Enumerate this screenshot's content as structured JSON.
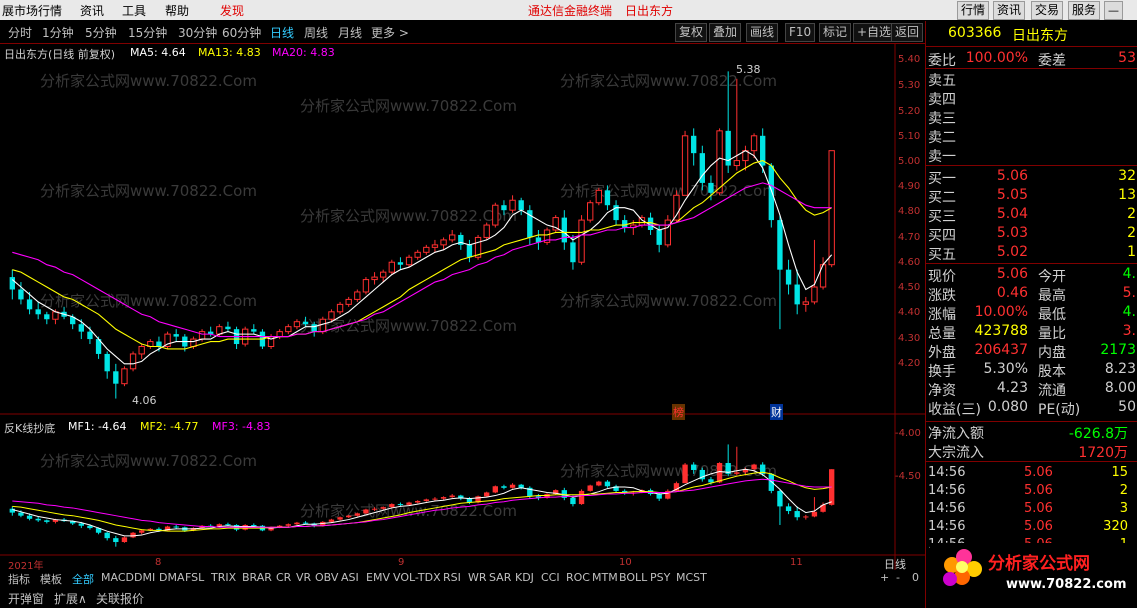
{
  "menu": {
    "items": [
      "展市场行情",
      "资讯",
      "工具",
      "帮助",
      "发现"
    ],
    "promo": [
      "通达信金融终端",
      "日出东方"
    ],
    "right_buttons": [
      "行情",
      "资讯",
      "交易",
      "服务"
    ]
  },
  "toolbar": {
    "periods": [
      "分时",
      "1分钟",
      "5分钟",
      "15分钟",
      "30分钟",
      "60分钟",
      "日线",
      "周线",
      "月线",
      "更多 >"
    ],
    "selected": "日线",
    "actions": [
      "复权",
      "叠加",
      "画线",
      "F10",
      "标记",
      "+自选",
      "返回"
    ]
  },
  "main_chart": {
    "title": "日出东方(日线 前复权)",
    "ma_labels": [
      {
        "text": "MA5: 4.64",
        "color": "#ffffff"
      },
      {
        "text": "MA13: 4.83",
        "color": "#ffff00"
      },
      {
        "text": "MA20: 4.83",
        "color": "#ff00ff"
      }
    ],
    "high_label": "5.38",
    "low_label": "4.06",
    "price_ticks": [
      "5.40",
      "5.30",
      "5.20",
      "5.10",
      "5.00",
      "4.90",
      "4.80",
      "4.70",
      "4.60",
      "4.50",
      "4.40",
      "4.30",
      "4.20"
    ],
    "markers": [
      "榜",
      "财"
    ]
  },
  "sub_chart": {
    "title": "反K线抄底",
    "labels": [
      {
        "text": "MF1: -4.64",
        "color": "#ffffff"
      },
      {
        "text": "MF2: -4.77",
        "color": "#ffff00"
      },
      {
        "text": "MF3: -4.83",
        "color": "#ff00ff"
      }
    ],
    "ticks": [
      "-4.00",
      "-4.50"
    ]
  },
  "time_axis": [
    "2021年",
    "8",
    "9",
    "10",
    "11"
  ],
  "period_label": "日线",
  "indicator_tabs": [
    "指标",
    "模板",
    "全部",
    "MACD",
    "DMI",
    "DMA",
    "FSL",
    "TRIX",
    "BRAR",
    "CR",
    "VR",
    "OBV",
    "ASI",
    "EMV",
    "VOL-TDX",
    "RSI",
    "WR",
    "SAR",
    "KDJ",
    "CCI",
    "ROC",
    "MTM",
    "BOLL",
    "PSY",
    "MCST"
  ],
  "bottom_tabs": [
    "开弹窗",
    "扩展∧",
    "关联报价"
  ],
  "zoom": {
    "plus": "+",
    "minus": "-",
    "value": "0"
  },
  "quote": {
    "code": "603366",
    "name": "日出东方",
    "weibi_label": "委比",
    "weibi": "100.00%",
    "weicha_label": "委差",
    "weicha": "53",
    "asks": [
      {
        "label": "卖五"
      },
      {
        "label": "卖四"
      },
      {
        "label": "卖三"
      },
      {
        "label": "卖二"
      },
      {
        "label": "卖一"
      }
    ],
    "bids": [
      {
        "label": "买一",
        "price": "5.06",
        "vol": "32"
      },
      {
        "label": "买二",
        "price": "5.05",
        "vol": "13"
      },
      {
        "label": "买三",
        "price": "5.04",
        "vol": "2"
      },
      {
        "label": "买四",
        "price": "5.03",
        "vol": "2"
      },
      {
        "label": "买五",
        "price": "5.02",
        "vol": "1"
      }
    ],
    "stats": [
      {
        "l1": "现价",
        "v1": "5.06",
        "c1": "#ff3030",
        "l2": "今开",
        "v2": "4.",
        "c2": "#00ff00"
      },
      {
        "l1": "涨跌",
        "v1": "0.46",
        "c1": "#ff3030",
        "l2": "最高",
        "v2": "5.",
        "c2": "#ff3030"
      },
      {
        "l1": "涨幅",
        "v1": "10.00%",
        "c1": "#ff3030",
        "l2": "最低",
        "v2": "4.",
        "c2": "#00ff00"
      },
      {
        "l1": "总量",
        "v1": "423788",
        "c1": "#ffff00",
        "l2": "量比",
        "v2": "3.",
        "c2": "#ff3030"
      },
      {
        "l1": "外盘",
        "v1": "206437",
        "c1": "#ff3030",
        "l2": "内盘",
        "v2": "2173",
        "c2": "#00ff00"
      },
      {
        "l1": "换手",
        "v1": "5.30%",
        "c1": "#d0d0d0",
        "l2": "股本",
        "v2": "8.23",
        "c2": "#d0d0d0"
      },
      {
        "l1": "净资",
        "v1": "4.23",
        "c1": "#d0d0d0",
        "l2": "流通",
        "v2": "8.00",
        "c2": "#d0d0d0"
      },
      {
        "l1": "收益(三)",
        "v1": "0.080",
        "c1": "#d0d0d0",
        "l2": "PE(动)",
        "v2": "50",
        "c2": "#d0d0d0"
      }
    ],
    "flow": [
      {
        "label": "净流入额",
        "value": "-626.8万",
        "color": "#00ff00"
      },
      {
        "label": "大宗流入",
        "value": "1720万",
        "color": "#ff3030"
      }
    ],
    "ticks": [
      {
        "t": "14:56",
        "p": "5.06",
        "v": "15"
      },
      {
        "t": "14:56",
        "p": "5.06",
        "v": "2"
      },
      {
        "t": "14:56",
        "p": "5.06",
        "v": "3"
      },
      {
        "t": "14:56",
        "p": "5.06",
        "v": "320"
      },
      {
        "t": "14:56",
        "p": "5.06",
        "v": "1"
      }
    ]
  },
  "watermark": "分析家公式网www.70822.Com",
  "logo": {
    "text": "分析家公式网",
    "url": "www.70822.com"
  },
  "chart_data": {
    "type": "candlestick",
    "ylim": [
      4.03,
      5.45
    ],
    "candles": [
      [
        4.55,
        4.58,
        4.46,
        4.5
      ],
      [
        4.5,
        4.53,
        4.44,
        4.46
      ],
      [
        4.46,
        4.49,
        4.4,
        4.42
      ],
      [
        4.42,
        4.45,
        4.38,
        4.4
      ],
      [
        4.4,
        4.41,
        4.36,
        4.38
      ],
      [
        4.38,
        4.42,
        4.36,
        4.41
      ],
      [
        4.41,
        4.43,
        4.38,
        4.39
      ],
      [
        4.39,
        4.4,
        4.34,
        4.36
      ],
      [
        4.36,
        4.38,
        4.3,
        4.33
      ],
      [
        4.33,
        4.35,
        4.28,
        4.3
      ],
      [
        4.3,
        4.31,
        4.22,
        4.24
      ],
      [
        4.24,
        4.25,
        4.14,
        4.17
      ],
      [
        4.17,
        4.2,
        4.06,
        4.12
      ],
      [
        4.12,
        4.19,
        4.11,
        4.18
      ],
      [
        4.18,
        4.25,
        4.17,
        4.24
      ],
      [
        4.24,
        4.28,
        4.22,
        4.27
      ],
      [
        4.27,
        4.3,
        4.26,
        4.29
      ],
      [
        4.29,
        4.31,
        4.25,
        4.27
      ],
      [
        4.27,
        4.33,
        4.26,
        4.32
      ],
      [
        4.32,
        4.34,
        4.29,
        4.31
      ],
      [
        4.31,
        4.32,
        4.25,
        4.27
      ],
      [
        4.27,
        4.31,
        4.26,
        4.3
      ],
      [
        4.3,
        4.34,
        4.29,
        4.33
      ],
      [
        4.33,
        4.35,
        4.31,
        4.32
      ],
      [
        4.32,
        4.36,
        4.31,
        4.35
      ],
      [
        4.35,
        4.37,
        4.33,
        4.34
      ],
      [
        4.34,
        4.35,
        4.26,
        4.28
      ],
      [
        4.28,
        4.35,
        4.27,
        4.34
      ],
      [
        4.34,
        4.36,
        4.32,
        4.33
      ],
      [
        4.33,
        4.34,
        4.26,
        4.27
      ],
      [
        4.27,
        4.32,
        4.26,
        4.31
      ],
      [
        4.31,
        4.34,
        4.3,
        4.33
      ],
      [
        4.33,
        4.36,
        4.32,
        4.35
      ],
      [
        4.35,
        4.38,
        4.34,
        4.37
      ],
      [
        4.37,
        4.39,
        4.35,
        4.36
      ],
      [
        4.36,
        4.37,
        4.31,
        4.33
      ],
      [
        4.33,
        4.39,
        4.32,
        4.38
      ],
      [
        4.38,
        4.42,
        4.37,
        4.41
      ],
      [
        4.41,
        4.45,
        4.4,
        4.44
      ],
      [
        4.44,
        4.47,
        4.43,
        4.46
      ],
      [
        4.46,
        4.5,
        4.45,
        4.49
      ],
      [
        4.49,
        4.55,
        4.48,
        4.54
      ],
      [
        4.54,
        4.57,
        4.52,
        4.55
      ],
      [
        4.55,
        4.58,
        4.53,
        4.57
      ],
      [
        4.57,
        4.62,
        4.56,
        4.61
      ],
      [
        4.61,
        4.63,
        4.58,
        4.6
      ],
      [
        4.6,
        4.64,
        4.59,
        4.63
      ],
      [
        4.63,
        4.66,
        4.62,
        4.65
      ],
      [
        4.65,
        4.68,
        4.64,
        4.67
      ],
      [
        4.67,
        4.7,
        4.65,
        4.68
      ],
      [
        4.68,
        4.71,
        4.66,
        4.7
      ],
      [
        4.7,
        4.74,
        4.69,
        4.72
      ],
      [
        4.72,
        4.73,
        4.66,
        4.68
      ],
      [
        4.68,
        4.7,
        4.61,
        4.63
      ],
      [
        4.63,
        4.72,
        4.62,
        4.71
      ],
      [
        4.71,
        4.77,
        4.7,
        4.76
      ],
      [
        4.76,
        4.85,
        4.75,
        4.84
      ],
      [
        4.84,
        4.86,
        4.8,
        4.82
      ],
      [
        4.82,
        4.88,
        4.81,
        4.86
      ],
      [
        4.86,
        4.87,
        4.8,
        4.82
      ],
      [
        4.82,
        4.84,
        4.68,
        4.71
      ],
      [
        4.71,
        4.74,
        4.66,
        4.69
      ],
      [
        4.69,
        4.75,
        4.68,
        4.74
      ],
      [
        4.74,
        4.8,
        4.73,
        4.79
      ],
      [
        4.79,
        4.82,
        4.66,
        4.69
      ],
      [
        4.69,
        4.72,
        4.58,
        4.61
      ],
      [
        4.61,
        4.8,
        4.6,
        4.78
      ],
      [
        4.78,
        4.86,
        4.77,
        4.85
      ],
      [
        4.85,
        4.91,
        4.84,
        4.9
      ],
      [
        4.9,
        4.92,
        4.82,
        4.84
      ],
      [
        4.84,
        4.86,
        4.76,
        4.78
      ],
      [
        4.78,
        4.8,
        4.73,
        4.75
      ],
      [
        4.75,
        4.78,
        4.72,
        4.76
      ],
      [
        4.76,
        4.8,
        4.75,
        4.79
      ],
      [
        4.79,
        4.81,
        4.72,
        4.74
      ],
      [
        4.74,
        4.76,
        4.65,
        4.68
      ],
      [
        4.68,
        4.8,
        4.67,
        4.78
      ],
      [
        4.78,
        4.9,
        4.77,
        4.88
      ],
      [
        4.88,
        5.14,
        4.88,
        5.12
      ],
      [
        5.12,
        5.15,
        5.0,
        5.05
      ],
      [
        5.05,
        5.08,
        4.9,
        4.93
      ],
      [
        4.93,
        4.96,
        4.86,
        4.89
      ],
      [
        4.89,
        5.15,
        4.88,
        5.14
      ],
      [
        5.14,
        5.38,
        4.97,
        5.0
      ],
      [
        5.0,
        5.35,
        4.98,
        5.02
      ],
      [
        5.02,
        5.08,
        4.98,
        5.06
      ],
      [
        5.06,
        5.13,
        5.03,
        5.12
      ],
      [
        5.12,
        5.15,
        4.97,
        5.0
      ],
      [
        5.0,
        5.01,
        4.75,
        4.78
      ],
      [
        4.78,
        4.8,
        4.34,
        4.58
      ],
      [
        4.58,
        4.62,
        4.48,
        4.52
      ],
      [
        4.52,
        4.58,
        4.4,
        4.44
      ],
      [
        4.44,
        4.47,
        4.41,
        4.45
      ],
      [
        4.45,
        4.7,
        4.44,
        4.51
      ],
      [
        4.51,
        4.63,
        4.5,
        4.6
      ],
      [
        4.6,
        5.06,
        4.59,
        5.06
      ]
    ],
    "series": [
      {
        "name": "MA5",
        "color": "#ffffff",
        "values": [
          4.54,
          4.51,
          4.48,
          4.45,
          4.43,
          4.41,
          4.4,
          4.39,
          4.37,
          4.34,
          4.3,
          4.26,
          4.23,
          4.2,
          4.2,
          4.21,
          4.24,
          4.26,
          4.28,
          4.29,
          4.29,
          4.29,
          4.3,
          4.3,
          4.32,
          4.33,
          4.32,
          4.32,
          4.32,
          4.31,
          4.3,
          4.31,
          4.31,
          4.33,
          4.35,
          4.35,
          4.36,
          4.37,
          4.39,
          4.41,
          4.44,
          4.47,
          4.5,
          4.53,
          4.56,
          4.58,
          4.59,
          4.61,
          4.63,
          4.65,
          4.66,
          4.68,
          4.69,
          4.68,
          4.69,
          4.7,
          4.72,
          4.75,
          4.8,
          4.82,
          4.8,
          4.78,
          4.76,
          4.75,
          4.73,
          4.7,
          4.72,
          4.74,
          4.77,
          4.81,
          4.83,
          4.83,
          4.82,
          4.78,
          4.76,
          4.74,
          4.75,
          4.8,
          4.86,
          4.91,
          4.96,
          5.0,
          5.03,
          5.02,
          5.04,
          5.06,
          5.04,
          4.99,
          4.9,
          4.8,
          4.68,
          4.57,
          4.5,
          4.52,
          4.6,
          4.64
        ]
      },
      {
        "name": "MA13",
        "color": "#ffff00",
        "values": [
          4.58,
          4.57,
          4.55,
          4.53,
          4.51,
          4.49,
          4.47,
          4.46,
          4.44,
          4.42,
          4.4,
          4.37,
          4.34,
          4.32,
          4.3,
          4.28,
          4.27,
          4.27,
          4.26,
          4.26,
          4.26,
          4.27,
          4.28,
          4.29,
          4.29,
          4.3,
          4.3,
          4.3,
          4.3,
          4.3,
          4.31,
          4.31,
          4.31,
          4.32,
          4.32,
          4.33,
          4.33,
          4.34,
          4.35,
          4.36,
          4.37,
          4.39,
          4.41,
          4.43,
          4.45,
          4.47,
          4.5,
          4.52,
          4.54,
          4.56,
          4.58,
          4.6,
          4.62,
          4.63,
          4.64,
          4.65,
          4.66,
          4.68,
          4.69,
          4.7,
          4.71,
          4.72,
          4.72,
          4.73,
          4.73,
          4.73,
          4.73,
          4.74,
          4.74,
          4.75,
          4.76,
          4.76,
          4.77,
          4.77,
          4.77,
          4.76,
          4.76,
          4.77,
          4.8,
          4.83,
          4.85,
          4.88,
          4.91,
          4.94,
          4.97,
          4.99,
          5.01,
          5.02,
          5.0,
          4.95,
          4.91,
          4.86,
          4.82,
          4.8,
          4.81,
          4.83
        ]
      },
      {
        "name": "MA20",
        "color": "#ff00ff",
        "values": [
          4.65,
          4.64,
          4.63,
          4.62,
          4.6,
          4.59,
          4.57,
          4.56,
          4.54,
          4.52,
          4.5,
          4.48,
          4.46,
          4.44,
          4.42,
          4.4,
          4.39,
          4.37,
          4.36,
          4.35,
          4.34,
          4.33,
          4.32,
          4.32,
          4.31,
          4.31,
          4.31,
          4.31,
          4.31,
          4.31,
          4.31,
          4.31,
          4.31,
          4.32,
          4.32,
          4.33,
          4.33,
          4.34,
          4.35,
          4.36,
          4.37,
          4.38,
          4.4,
          4.41,
          4.43,
          4.45,
          4.47,
          4.49,
          4.51,
          4.53,
          4.54,
          4.56,
          4.57,
          4.58,
          4.6,
          4.61,
          4.63,
          4.64,
          4.66,
          4.67,
          4.68,
          4.69,
          4.7,
          4.7,
          4.71,
          4.71,
          4.72,
          4.72,
          4.73,
          4.74,
          4.74,
          4.75,
          4.75,
          4.76,
          4.76,
          4.76,
          4.76,
          4.77,
          4.78,
          4.79,
          4.81,
          4.83,
          4.85,
          4.87,
          4.89,
          4.91,
          4.92,
          4.93,
          4.92,
          4.9,
          4.88,
          4.86,
          4.84,
          4.83,
          4.83,
          4.83
        ]
      }
    ]
  }
}
